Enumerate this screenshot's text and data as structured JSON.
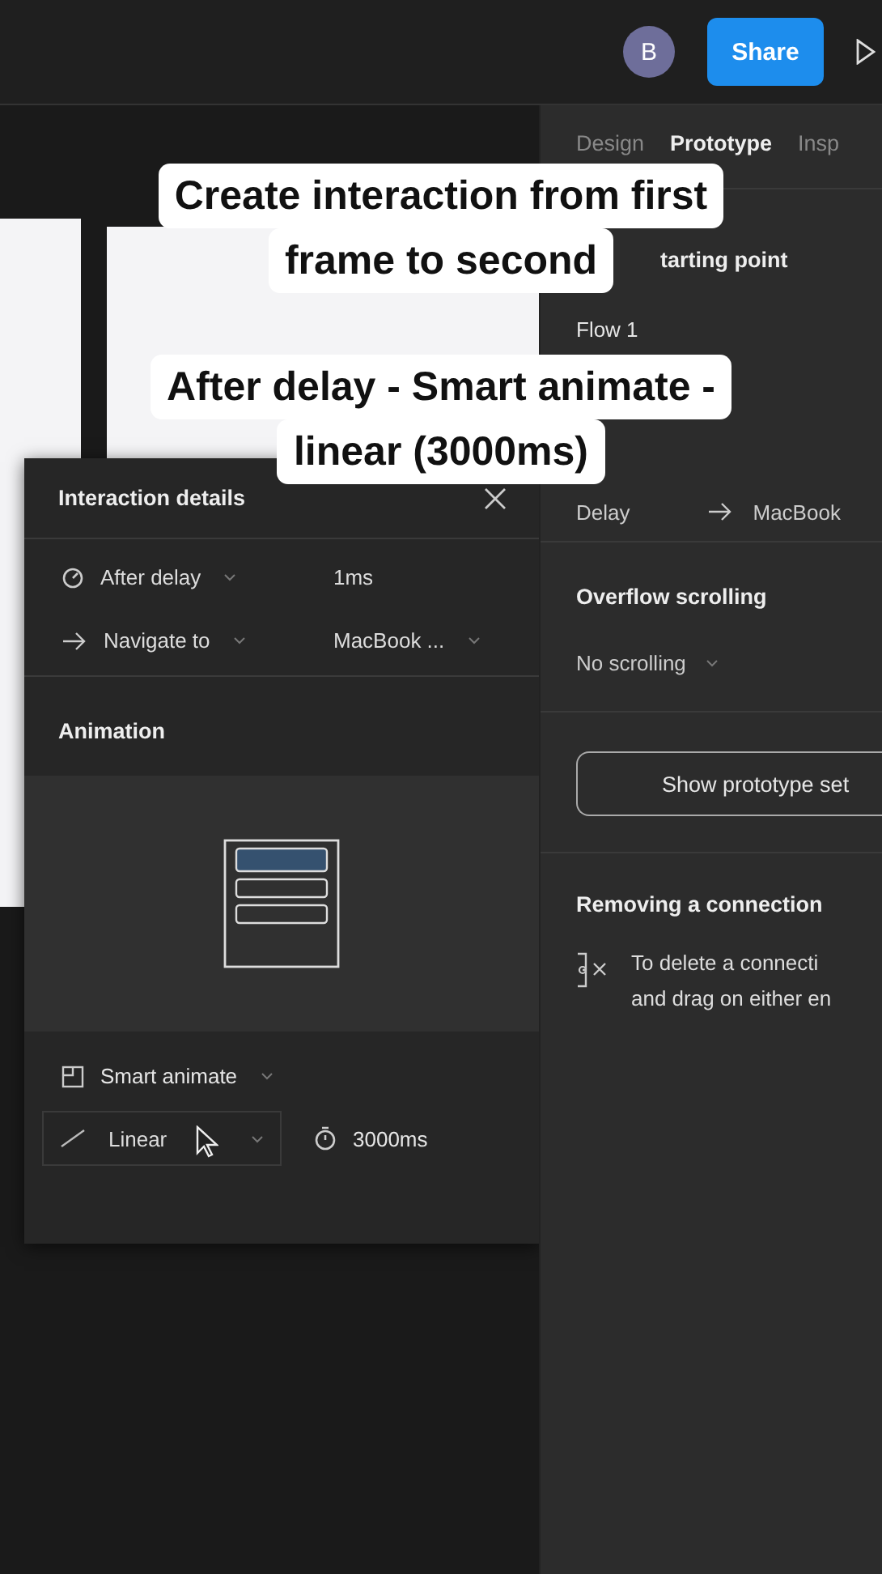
{
  "toolbar": {
    "avatar": "B",
    "share": "Share"
  },
  "right_panel": {
    "tabs": [
      {
        "label": "Design",
        "selected": false
      },
      {
        "label": "Prototype",
        "selected": true
      },
      {
        "label": "Insp",
        "selected": false
      }
    ],
    "flow_heading": "tarting point",
    "flow_name": "Flow 1",
    "interaction": {
      "trigger": "Delay",
      "destination": "MacBook"
    },
    "overflow": {
      "heading": "Overflow scrolling",
      "value": "No scrolling"
    },
    "settings_button": "Show prototype set",
    "removing": {
      "heading": "Removing a connection",
      "lines": [
        "To delete a connecti",
        "and drag on either en"
      ]
    }
  },
  "interaction_details": {
    "title": "Interaction details",
    "trigger": "After delay",
    "delay": "1ms",
    "action": "Navigate to",
    "destination": "MacBook ...",
    "animation_heading": "Animation",
    "animation": "Smart animate",
    "easing": "Linear",
    "duration": "3000ms"
  },
  "captions": [
    {
      "lines": [
        "Create interaction from first",
        "frame to second"
      ]
    },
    {
      "lines": [
        "After delay - Smart animate -",
        "linear (3000ms)"
      ]
    }
  ]
}
